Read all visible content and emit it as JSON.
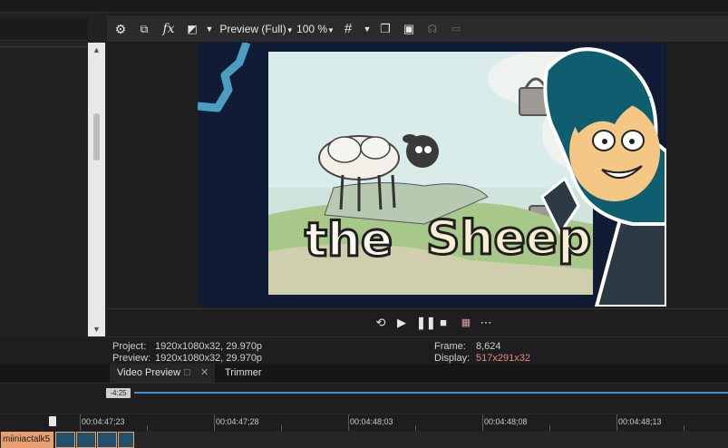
{
  "toolbar": {
    "preview_quality": "Preview (Full)",
    "zoom": "100 %"
  },
  "video": {
    "text_the": "the",
    "text_sheep": "Sheep"
  },
  "info": {
    "project_label": "Project:",
    "project_value": "1920x1080x32, 29.970p",
    "preview_label": "Preview:",
    "preview_value": "1920x1080x32, 29.970p",
    "frame_label": "Frame:",
    "frame_value": "8,624",
    "display_label": "Display:",
    "display_value": "517x291x32"
  },
  "tabs": {
    "video_preview": "Video Preview",
    "trimmer": "Trimmer"
  },
  "timeline": {
    "time_box": "-4:25",
    "ruler_labels": [
      "00:04:47;23",
      "00:04:47;28",
      "00:04:48;03",
      "00:04:48;08",
      "00:04:48;13"
    ]
  },
  "track": {
    "clip_name": "miiniactalk5"
  },
  "colors": {
    "accent_blue": "#3a8fd8",
    "display_value_red": "#e58787",
    "clip_orange": "#e8a070"
  }
}
